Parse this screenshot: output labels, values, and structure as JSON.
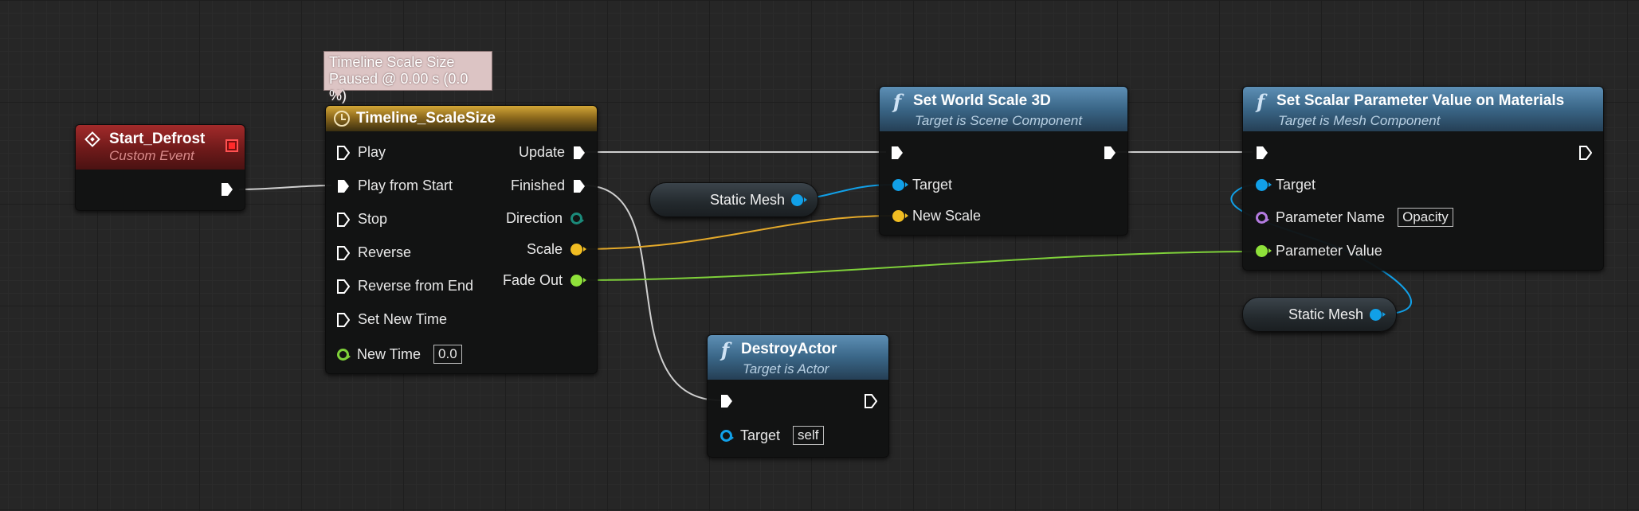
{
  "tooltip": {
    "line1": "Timeline Scale Size",
    "line2": "Paused @ 0.00 s (0.0 %)"
  },
  "start_node": {
    "title": "Start_Defrost",
    "subtitle": "Custom Event"
  },
  "timeline_node": {
    "title": "Timeline_ScaleSize",
    "inputs": [
      "Play",
      "Play from Start",
      "Stop",
      "Reverse",
      "Reverse from End",
      "Set New Time"
    ],
    "new_time_label": "New Time",
    "new_time_value": "0.0",
    "outputs": {
      "update": "Update",
      "finished": "Finished",
      "direction": "Direction",
      "scale": "Scale",
      "fade_out": "Fade Out"
    }
  },
  "set_world_scale": {
    "title": "Set World Scale 3D",
    "subtitle": "Target is Scene Component",
    "target_label": "Target",
    "new_scale_label": "New Scale"
  },
  "set_scalar_param": {
    "title": "Set Scalar Parameter Value on Materials",
    "subtitle": "Target is Mesh Component",
    "target_label": "Target",
    "param_name_label": "Parameter Name",
    "param_name_value": "Opacity",
    "param_value_label": "Parameter Value"
  },
  "destroy_actor": {
    "title": "DestroyActor",
    "subtitle": "Target is Actor",
    "target_label": "Target",
    "target_value": "self"
  },
  "static_mesh_var_1": {
    "label": "Static Mesh"
  },
  "static_mesh_var_2": {
    "label": "Static Mesh"
  },
  "colors": {
    "exec": "#ffffff",
    "object": "#11a0e8",
    "vector": "#f1bd22",
    "float": "#8fe23a",
    "name": "#b47be0",
    "timeline_direction": "#1b8a7a",
    "wire_exec": "#d6d6d6"
  }
}
